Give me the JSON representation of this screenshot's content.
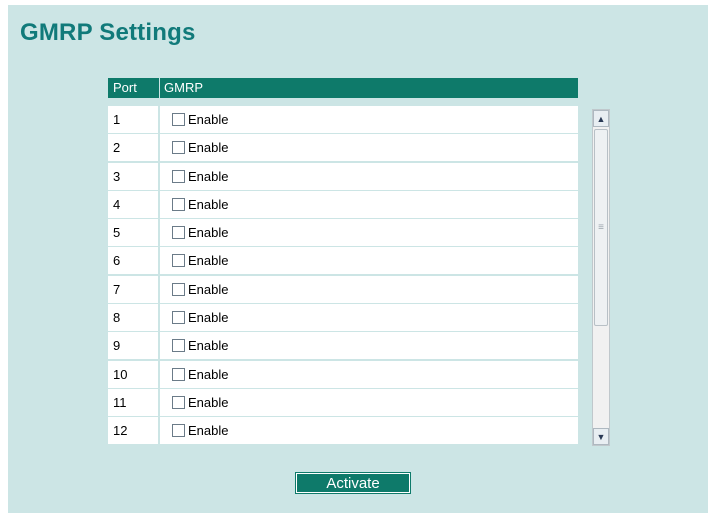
{
  "page": {
    "title": "GMRP Settings"
  },
  "table": {
    "headers": {
      "port": "Port",
      "gmrp": "GMRP"
    },
    "rows": [
      {
        "port": "1",
        "label": "Enable",
        "checked": false
      },
      {
        "port": "2",
        "label": "Enable",
        "checked": false
      },
      {
        "port": "3",
        "label": "Enable",
        "checked": false
      },
      {
        "port": "4",
        "label": "Enable",
        "checked": false
      },
      {
        "port": "5",
        "label": "Enable",
        "checked": false
      },
      {
        "port": "6",
        "label": "Enable",
        "checked": false
      },
      {
        "port": "7",
        "label": "Enable",
        "checked": false
      },
      {
        "port": "8",
        "label": "Enable",
        "checked": false
      },
      {
        "port": "9",
        "label": "Enable",
        "checked": false
      },
      {
        "port": "10",
        "label": "Enable",
        "checked": false
      },
      {
        "port": "11",
        "label": "Enable",
        "checked": false
      },
      {
        "port": "12",
        "label": "Enable",
        "checked": false
      }
    ]
  },
  "actions": {
    "activate_label": "Activate"
  },
  "icons": {
    "scroll_up": "chevron-up-icon",
    "scroll_down": "chevron-down-icon",
    "grip": "grip-icon"
  },
  "colors": {
    "background": "#cce5e5",
    "accent": "#0e7a6a",
    "title": "#117a7a"
  }
}
